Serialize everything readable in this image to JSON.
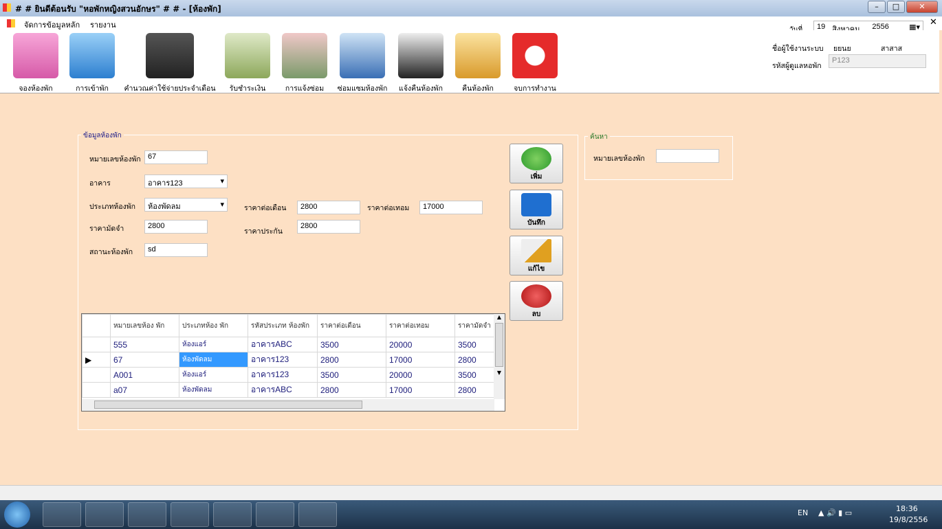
{
  "window": {
    "title": "# # ยินดีต้อนรับ \"หอพักหญิงสวนอักษร\" # # - [ห้องพัก]",
    "min": "–",
    "max": "□",
    "close": "✕"
  },
  "menu": [
    "จัดการข้อมูลหลัก",
    "รายงาน"
  ],
  "toolbar": [
    "จองห้องพัก",
    "การเข้าพัก",
    "คำนวณค่าใช้จ่ายประจำเดือน",
    "รับชำระเงิน",
    "การแจ้งซ่อม",
    "ซ่อมแซมห้องพัก",
    "แจ้งคืนห้องพัก",
    "คืนห้องพัก",
    "จบการทำงาน"
  ],
  "header": {
    "date_label": "วันที่",
    "day": "19",
    "month": "สิงหาคม",
    "year": "2556",
    "user_label": "ชื่อผู้ใช้งานระบบ",
    "first_name": "ยยนย",
    "last_name": "สาสาส",
    "admin_label": "รหัสผู้ดูแลหอพัก",
    "admin_id": "P123",
    "child_close": "✕"
  },
  "form": {
    "group": "ข้อมูลห้องพัก",
    "room_no_label": "หมายเลขห้องพัก",
    "room_no": "67",
    "building_label": "อาคาร",
    "building": "อาคาร123",
    "type_label": "ประเภทห้องพัก",
    "type": "ห้องพัดลม",
    "monthly_label": "ราคาต่อเดือน",
    "monthly": "2800",
    "term_label": "ราคาต่อเทอม",
    "term": "17000",
    "deposit_label": "ราคามัดจำ",
    "deposit": "2800",
    "insurance_label": "ราคาประกัน",
    "insurance": "2800",
    "status_label": "สถานะห้องพัก",
    "status": "sd"
  },
  "buttons": {
    "add": "เพิ่ม",
    "save": "บันทึก",
    "edit": "แก้ไข",
    "delete": "ลบ"
  },
  "search": {
    "group": "ค้นหา",
    "label": "หมายเลขห้องพัก",
    "value": ""
  },
  "grid": {
    "columns": [
      "หมายเลขห้อง พัก",
      "ประเภทห้อง พัก",
      "รหัสประเภท ห้องพัก",
      "ราคาต่อเดือน",
      "ราคาต่อเทอม",
      "ราคามัดจำ"
    ],
    "rows": [
      [
        "555",
        "ห้องแอร์",
        "อาคารABC",
        "3500",
        "20000",
        "3500"
      ],
      [
        "67",
        "ห้องพัดลม",
        "อาคาร123",
        "2800",
        "17000",
        "2800"
      ],
      [
        "A001",
        "ห้องแอร์",
        "อาคาร123",
        "3500",
        "20000",
        "3500"
      ],
      [
        "a07",
        "ห้องพัดลม",
        "อาคารABC",
        "2800",
        "17000",
        "2800"
      ]
    ],
    "selected_row": 1
  },
  "taskbar": {
    "lang": "EN",
    "time": "18:36",
    "date": "19/8/2556"
  }
}
